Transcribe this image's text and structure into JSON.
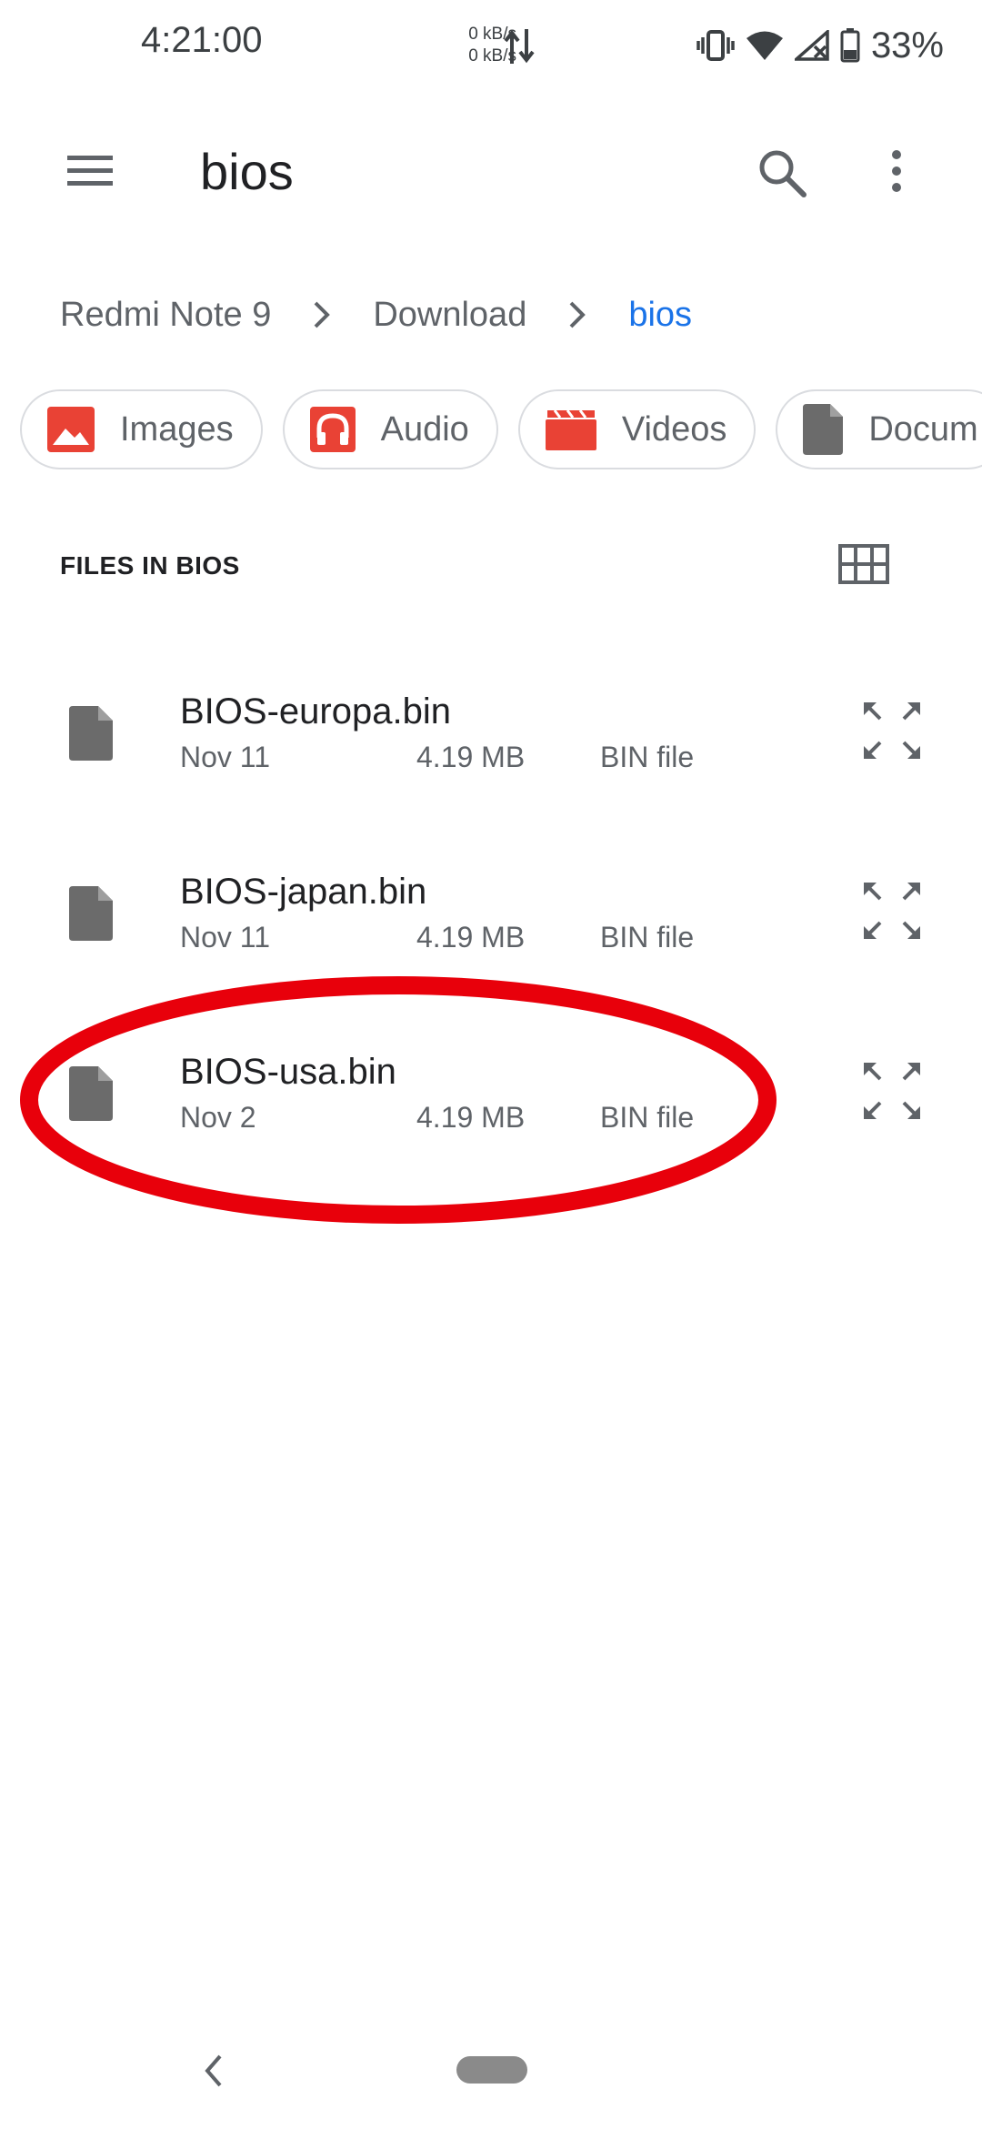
{
  "status_bar": {
    "time": "4:21:00",
    "net_up": "0 kB/s",
    "net_down": "0 kB/s",
    "battery_percent": "33%",
    "icons": [
      "vibrate-icon",
      "wifi-icon",
      "signal-no-service-icon",
      "battery-icon"
    ]
  },
  "app_bar": {
    "title": "bios",
    "icons": [
      "menu-icon",
      "search-icon",
      "more-vert-icon"
    ]
  },
  "breadcrumb": {
    "items": [
      "Redmi Note 9",
      "Download",
      "bios"
    ],
    "active_index": 2
  },
  "chips": [
    {
      "label": "Images",
      "icon": "image-icon"
    },
    {
      "label": "Audio",
      "icon": "headphones-icon"
    },
    {
      "label": "Videos",
      "icon": "clapperboard-icon"
    },
    {
      "label": "Docum",
      "icon": "document-icon"
    }
  ],
  "section": {
    "title": "FILES IN BIOS",
    "view_toggle_icon": "grid-view-icon"
  },
  "files": [
    {
      "name": "BIOS-europa.bin",
      "date": "Nov 11",
      "size": "4.19 MB",
      "type": "BIN file"
    },
    {
      "name": "BIOS-japan.bin",
      "date": "Nov 11",
      "size": "4.19 MB",
      "type": "BIN file"
    },
    {
      "name": "BIOS-usa.bin",
      "date": "Nov 2",
      "size": "4.19 MB",
      "type": "BIN file"
    }
  ],
  "annotation": {
    "highlighted_file": "BIOS-usa.bin",
    "color": "#e8000b"
  },
  "colors": {
    "accent": "#1a73e8",
    "chip_icon_red": "#e94235",
    "icon_gray": "#5f6368",
    "file_icon_gray": "#6b6b6b"
  },
  "nav_bar": {
    "icons": [
      "back-icon",
      "home-pill"
    ]
  }
}
